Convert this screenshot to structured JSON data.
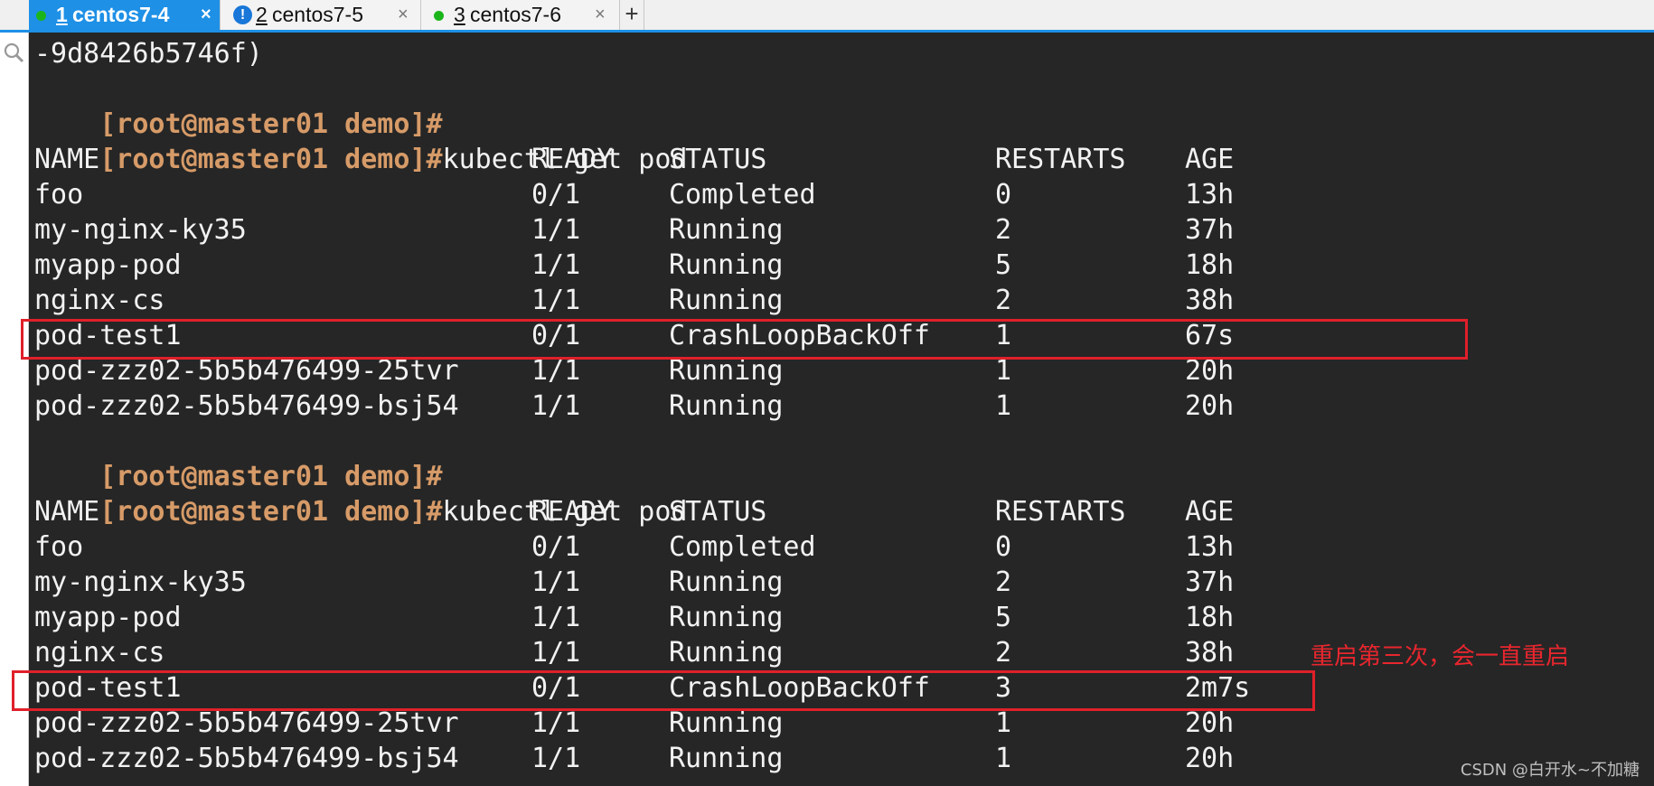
{
  "tabs": [
    {
      "number": "1",
      "title": "centos7-4",
      "active": true,
      "status": "connected"
    },
    {
      "number": "2",
      "title": "centos7-5",
      "active": false,
      "status": "warning"
    },
    {
      "number": "3",
      "title": "centos7-6",
      "active": false,
      "status": "connected"
    }
  ],
  "tab_close": "×",
  "tab_add": "+",
  "terminal": {
    "first_line": "-9d8426b5746f)",
    "prompt": "[root@master01 demo]#",
    "command": "kubectl get pod",
    "headers": {
      "name": "NAME",
      "ready": "READY",
      "status": "STATUS",
      "restarts": "RESTARTS",
      "age": "AGE"
    },
    "table1": [
      {
        "name": "foo",
        "ready": "0/1",
        "status": "Completed",
        "restarts": "0",
        "age": "13h"
      },
      {
        "name": "my-nginx-ky35",
        "ready": "1/1",
        "status": "Running",
        "restarts": "2",
        "age": "37h"
      },
      {
        "name": "myapp-pod",
        "ready": "1/1",
        "status": "Running",
        "restarts": "5",
        "age": "18h"
      },
      {
        "name": "nginx-cs",
        "ready": "1/1",
        "status": "Running",
        "restarts": "2",
        "age": "38h"
      },
      {
        "name": "pod-test1",
        "ready": "0/1",
        "status": "CrashLoopBackOff",
        "restarts": "1",
        "age": "67s"
      },
      {
        "name": "pod-zzz02-5b5b476499-25tvr",
        "ready": "1/1",
        "status": "Running",
        "restarts": "1",
        "age": "20h"
      },
      {
        "name": "pod-zzz02-5b5b476499-bsj54",
        "ready": "1/1",
        "status": "Running",
        "restarts": "1",
        "age": "20h"
      }
    ],
    "table2": [
      {
        "name": "foo",
        "ready": "0/1",
        "status": "Completed",
        "restarts": "0",
        "age": "13h"
      },
      {
        "name": "my-nginx-ky35",
        "ready": "1/1",
        "status": "Running",
        "restarts": "2",
        "age": "37h"
      },
      {
        "name": "myapp-pod",
        "ready": "1/1",
        "status": "Running",
        "restarts": "5",
        "age": "18h"
      },
      {
        "name": "nginx-cs",
        "ready": "1/1",
        "status": "Running",
        "restarts": "2",
        "age": "38h"
      },
      {
        "name": "pod-test1",
        "ready": "0/1",
        "status": "CrashLoopBackOff",
        "restarts": "3",
        "age": "2m7s"
      },
      {
        "name": "pod-zzz02-5b5b476499-25tvr",
        "ready": "1/1",
        "status": "Running",
        "restarts": "1",
        "age": "20h"
      },
      {
        "name": "pod-zzz02-5b5b476499-bsj54",
        "ready": "1/1",
        "status": "Running",
        "restarts": "1",
        "age": "20h"
      }
    ]
  },
  "annotation": "重启第三次，会一直重启",
  "watermark": "CSDN @白开水~不加糖",
  "colors": {
    "prompt": "#d79b68",
    "highlight": "#e0202a",
    "tab_active": "#1e90e6",
    "background": "#262626"
  }
}
